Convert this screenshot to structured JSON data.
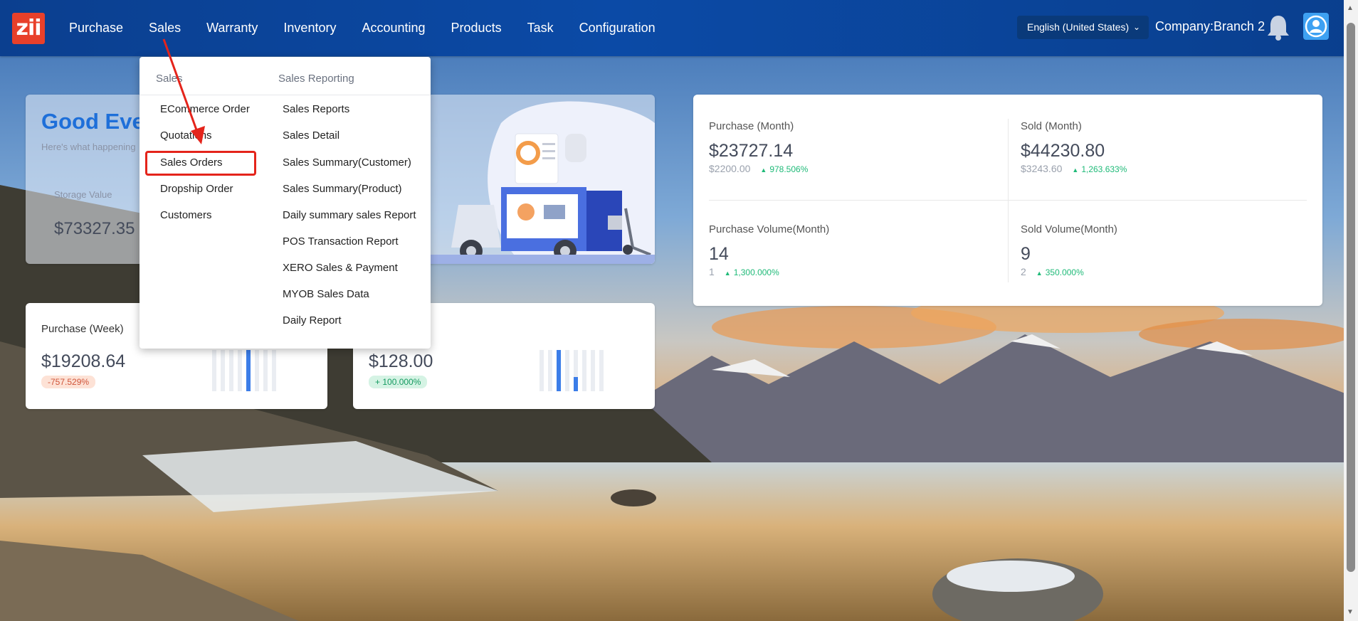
{
  "app": {
    "logo_text": "zii"
  },
  "nav": [
    "Purchase",
    "Sales",
    "Warranty",
    "Inventory",
    "Accounting",
    "Products",
    "Task",
    "Configuration"
  ],
  "header": {
    "language": "English (United States)",
    "company": "Company:Branch 2"
  },
  "welcome": {
    "title": "Good Eve",
    "subtitle": "Here's what happening",
    "storage_label": "Storage Value",
    "storage_value": "$73327.35"
  },
  "stats": {
    "purchase_month": {
      "label": "Purchase (Month)",
      "value": "$23727.14",
      "prev": "$2200.00",
      "change": "978.506%"
    },
    "sold_month": {
      "label": "Sold (Month)",
      "value": "$44230.80",
      "prev": "$3243.60",
      "change": "1,263.633%"
    },
    "purchase_volume": {
      "label": "Purchase Volume(Month)",
      "value": "14",
      "prev": "1",
      "change": "1,300.000%"
    },
    "sold_volume": {
      "label": "Sold Volume(Month)",
      "value": "9",
      "prev": "2",
      "change": "350.000%"
    }
  },
  "week_cards": {
    "purchase_week": {
      "label": "Purchase (Week)",
      "value": "$19208.64",
      "badge": "-757.529%",
      "bars": [
        0,
        0,
        0,
        0,
        1,
        0,
        0,
        0
      ]
    },
    "sold_week": {
      "value": "$128.00",
      "badge": "+ 100.000%",
      "bars": [
        0,
        0,
        1,
        0,
        0.35,
        0,
        0,
        0
      ]
    }
  },
  "dropdown": {
    "sales_header": "Sales",
    "reporting_header": "Sales Reporting",
    "sales_items": [
      "ECommerce Order",
      "Quotations",
      "Sales Orders",
      "Dropship Order",
      "Customers"
    ],
    "reporting_items": [
      "Sales Reports",
      "Sales Detail",
      "Sales Summary(Customer)",
      "Sales Summary(Product)",
      "Daily summary sales Report",
      "POS Transaction Report",
      "XERO Sales & Payment",
      "MYOB Sales Data",
      "Daily Report"
    ]
  },
  "colors": {
    "nav_bg": "#0b4aa6",
    "accent": "#1e6fd9",
    "positive": "#1fba78",
    "highlight": "#e4241b",
    "logo": "#e8402a"
  }
}
